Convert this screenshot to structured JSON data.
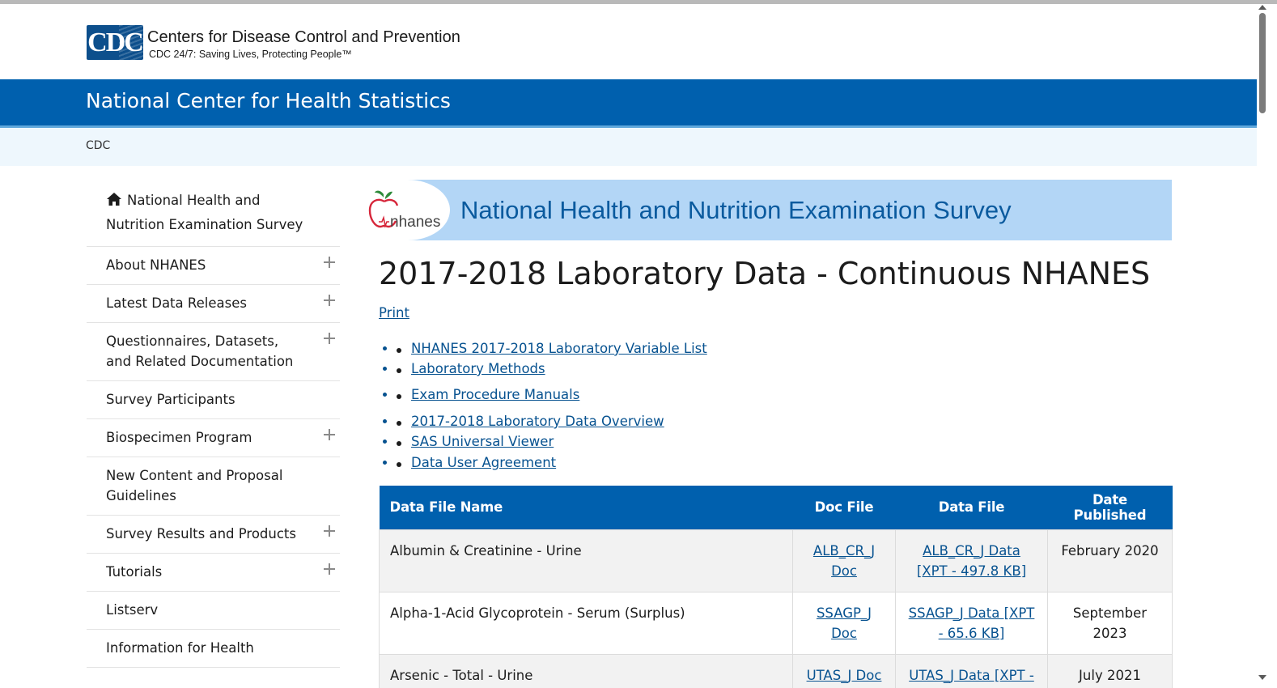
{
  "header": {
    "logo_text": "CDC",
    "org_name": "Centers for Disease Control and Prevention",
    "tagline": "CDC 24/7: Saving Lives, Protecting People™"
  },
  "site": {
    "title": "National Center for Health Statistics"
  },
  "breadcrumb": {
    "item": "CDC"
  },
  "sidenav": {
    "items": [
      {
        "label": "National Health and Nutrition Examination Survey",
        "expandable": false,
        "icon": "home-icon"
      },
      {
        "label": "About NHANES",
        "expandable": true
      },
      {
        "label": "Latest Data Releases",
        "expandable": true
      },
      {
        "label": "Questionnaires, Datasets, and Related Documentation",
        "expandable": true
      },
      {
        "label": "Survey Participants",
        "expandable": false
      },
      {
        "label": "Biospecimen Program",
        "expandable": true
      },
      {
        "label": "New Content and Proposal Guidelines",
        "expandable": false
      },
      {
        "label": "Survey Results and Products",
        "expandable": true
      },
      {
        "label": "Tutorials",
        "expandable": true
      },
      {
        "label": "Listserv",
        "expandable": false
      },
      {
        "label": "Information for Health",
        "expandable": false
      }
    ]
  },
  "banner": {
    "logo_word": "nhanes",
    "title": "National Health and Nutrition Examination Survey",
    "accent_color": "#b3d6f6"
  },
  "main": {
    "title": "2017-2018 Laboratory Data - Continuous NHANES",
    "print_label": "Print",
    "links": [
      "NHANES 2017-2018 Laboratory Variable List",
      "Laboratory Methods",
      "Exam Procedure Manuals",
      "2017-2018 Laboratory Data Overview",
      "SAS Universal Viewer",
      "Data User Agreement"
    ]
  },
  "table": {
    "headers": [
      "Data File Name",
      "Doc File",
      "Data File",
      "Date Published"
    ],
    "rows": [
      {
        "name": "Albumin & Creatinine - Urine",
        "doc": "ALB_CR_J Doc",
        "data": "ALB_CR_J Data [XPT - 497.8 KB]",
        "date": "February 2020"
      },
      {
        "name": "Alpha-1-Acid Glycoprotein - Serum (Surplus)",
        "doc": "SSAGP_J Doc",
        "data": "SSAGP_J Data [XPT - 65.6 KB]",
        "date": "September 2023"
      },
      {
        "name": "Arsenic - Total - Urine",
        "doc": "UTAS_J Doc",
        "data": "UTAS_J Data [XPT -",
        "date": "July 2021"
      }
    ]
  },
  "colors": {
    "brand_blue": "#0060ae",
    "link_blue": "#075290",
    "breadcrumb_bg": "#eef7fd"
  }
}
